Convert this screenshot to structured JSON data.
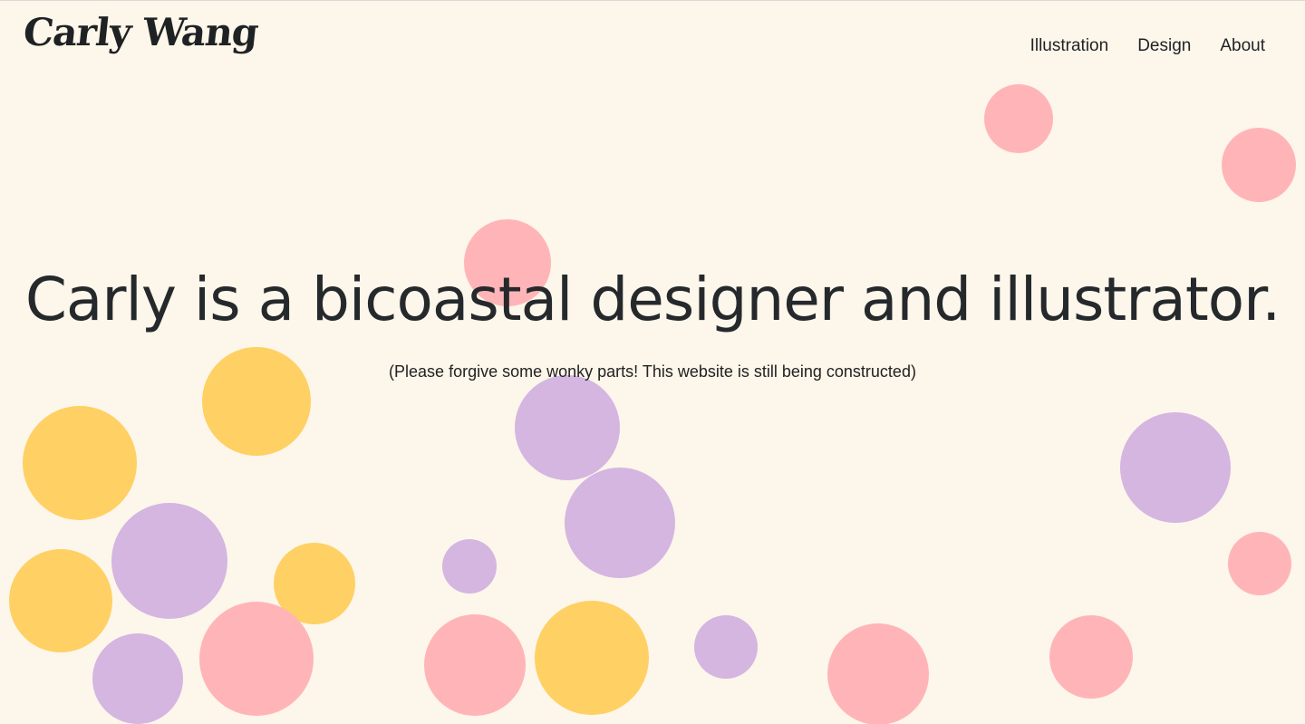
{
  "brand": {
    "logo_text": "Carly Wang"
  },
  "nav": {
    "items": [
      {
        "label": "Illustration"
      },
      {
        "label": "Design"
      },
      {
        "label": "About"
      }
    ]
  },
  "hero": {
    "headline": "Carly is a bicoastal designer and illustrator.",
    "note": "(Please forgive some wonky parts! This website is still being constructed)"
  },
  "palette": {
    "background": "#fdf6ea",
    "pink": "#ffb5b8",
    "yellow": "#ffd063",
    "lavender": "#d4b6e1",
    "text": "#25292c"
  }
}
